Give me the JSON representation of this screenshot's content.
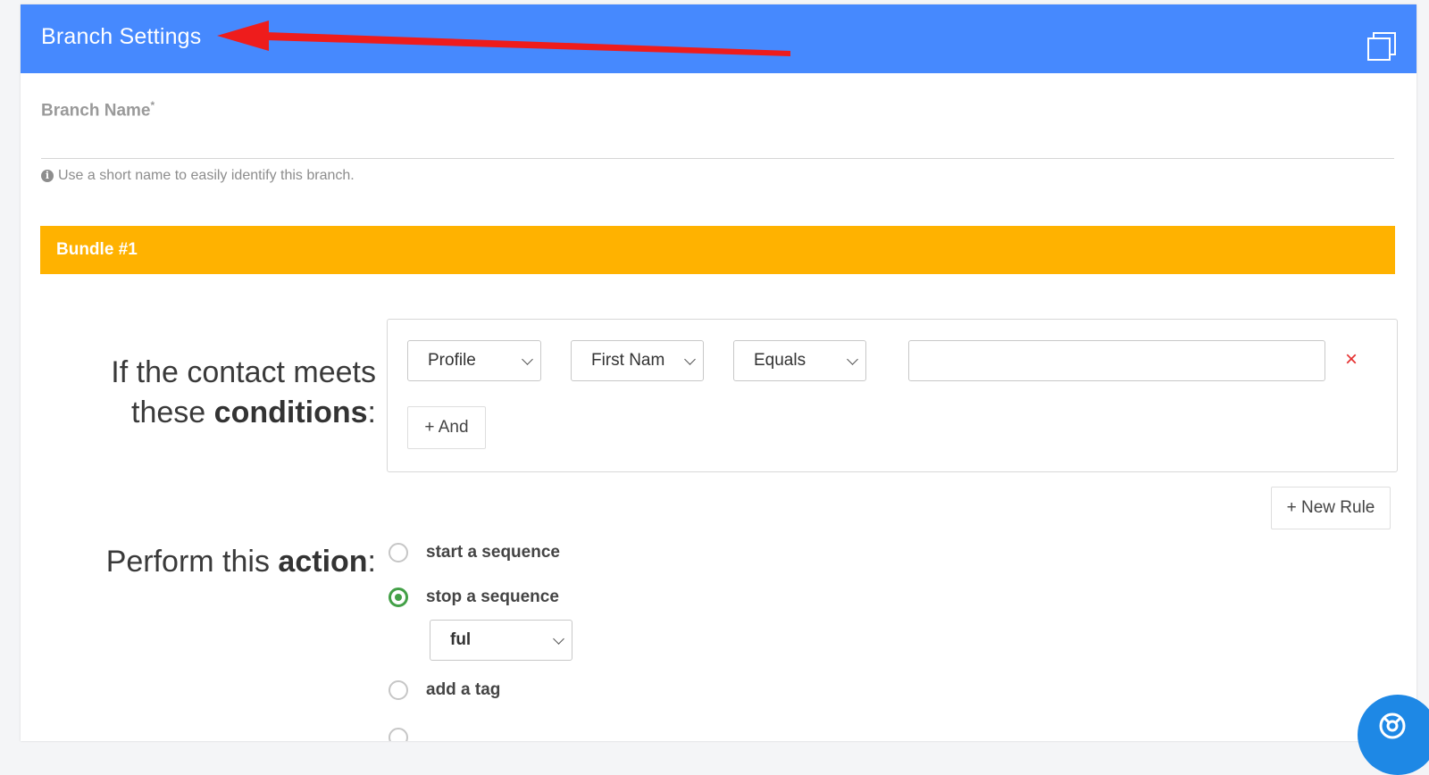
{
  "panel": {
    "title": "Branch Settings",
    "header_color": "#4689fe"
  },
  "branch_name": {
    "label": "Branch Name",
    "required_mark": "*",
    "value": "",
    "hint": "Use a short name to easily identify this branch."
  },
  "bundle": {
    "title": "Bundle #1",
    "color": "#ffb200"
  },
  "conditions": {
    "heading_prefix": "If the contact meets these ",
    "heading_bold": "conditions",
    "heading_suffix": ":",
    "rule": {
      "category": "Profile",
      "field": "First Nam",
      "operator": "Equals",
      "value": ""
    },
    "remove_symbol": "×",
    "and_label": "+ And",
    "new_rule_label": "+ New Rule"
  },
  "action": {
    "heading_prefix": "Perform this ",
    "heading_bold": "action",
    "heading_suffix": ":",
    "options": [
      {
        "label": "start a sequence",
        "checked": false
      },
      {
        "label": "stop a sequence",
        "checked": true
      },
      {
        "label": "add a tag",
        "checked": false
      }
    ],
    "sequence_select_value": "ful"
  },
  "icons": {
    "window": "window-restore-icon",
    "info": "info-icon",
    "chevron": "chevron-down-icon",
    "remove": "close-icon",
    "help": "help-chat-icon"
  }
}
